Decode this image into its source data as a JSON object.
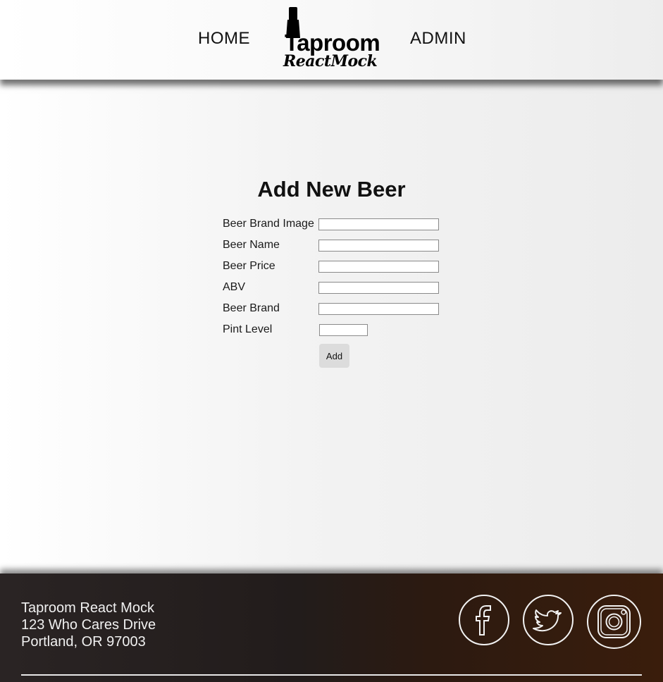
{
  "header": {
    "nav_home": "HOME",
    "nav_admin": "ADMIN",
    "logo_title": "Taproom",
    "logo_subtitle": "ReactMock"
  },
  "form": {
    "title": "Add New Beer",
    "fields": [
      {
        "label": "Beer Brand Image",
        "value": ""
      },
      {
        "label": "Beer Name",
        "value": ""
      },
      {
        "label": "Beer Price",
        "value": ""
      },
      {
        "label": "ABV",
        "value": ""
      },
      {
        "label": "Beer Brand",
        "value": ""
      },
      {
        "label": "Pint Level",
        "value": ""
      }
    ],
    "submit_label": "Add"
  },
  "footer": {
    "address_lines": [
      "Taproom React Mock",
      "123 Who Cares Drive",
      "Portland, OR 97003"
    ],
    "social_icons": [
      "facebook-icon",
      "twitter-icon",
      "instagram-icon"
    ]
  },
  "colors": {
    "footer_bg": "#221c1b",
    "footer_accent": "#3a1d0c",
    "text": "#111111"
  }
}
